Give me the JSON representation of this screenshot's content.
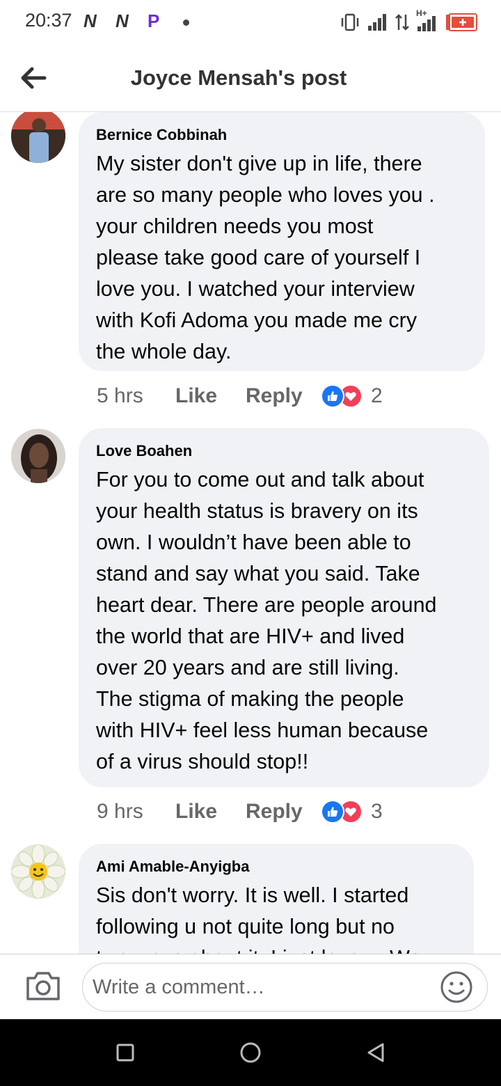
{
  "status_bar": {
    "time": "20:37",
    "notification_icons": [
      "nn-app-icon",
      "nn-app-icon",
      "p-app-icon",
      "dot-icon"
    ],
    "notif_letters": [
      "N",
      "N",
      "P"
    ],
    "system_icons": [
      "vibrate-icon",
      "signal-icon",
      "data-arrows-icon",
      "h-plus-signal-icon",
      "battery-charging-icon"
    ],
    "network_label": "H+"
  },
  "header": {
    "title": "Joyce Mensah's post",
    "back_icon": "arrow-left-icon"
  },
  "comments": [
    {
      "author": "Bernice Cobbinah",
      "lines": [
        "My sister don't  give up in life, there",
        "are so many people who loves you .",
        "your children needs you most",
        "please take good care of yourself I",
        "love you. I watched your interview",
        "with Kofi Adoma you made me cry",
        "the whole day."
      ],
      "time": "5 hrs",
      "like_label": "Like",
      "reply_label": "Reply",
      "reaction_count": "2",
      "reactions": [
        "like-reaction-icon",
        "love-reaction-icon"
      ]
    },
    {
      "author": "Love Boahen",
      "lines": [
        "For you to come out and talk about",
        "your health status is bravery on its",
        "own. I wouldn’t have been able to",
        "stand and say what you said. Take",
        "heart dear. There are people around",
        "the world that are HIV+ and lived",
        "over 20 years and are still living.",
        "The stigma of making the people",
        "with HIV+ feel less human because",
        "of a virus should stop!!"
      ],
      "time": "9 hrs",
      "like_label": "Like",
      "reply_label": "Reply",
      "reaction_count": "3",
      "reactions": [
        "like-reaction-icon",
        "love-reaction-icon"
      ]
    },
    {
      "author": "Ami Amable-Anyigba",
      "lines": [
        "Sis don't worry. It is well. I started",
        "following u not quite long but no",
        "two ways about it. I just love u. We"
      ]
    }
  ],
  "composer": {
    "placeholder": "Write a comment…",
    "camera_icon": "camera-icon",
    "emoji_icon": "smiley-icon"
  },
  "nav_bar": {
    "buttons": [
      "square-recents-icon",
      "circle-home-icon",
      "triangle-back-icon"
    ]
  },
  "colors": {
    "bubble": "#f0f2f5",
    "meta_text": "#65676b",
    "like_blue": "#1877f2",
    "love_red": "#f33e58",
    "battery_red": "#e74c3c"
  }
}
